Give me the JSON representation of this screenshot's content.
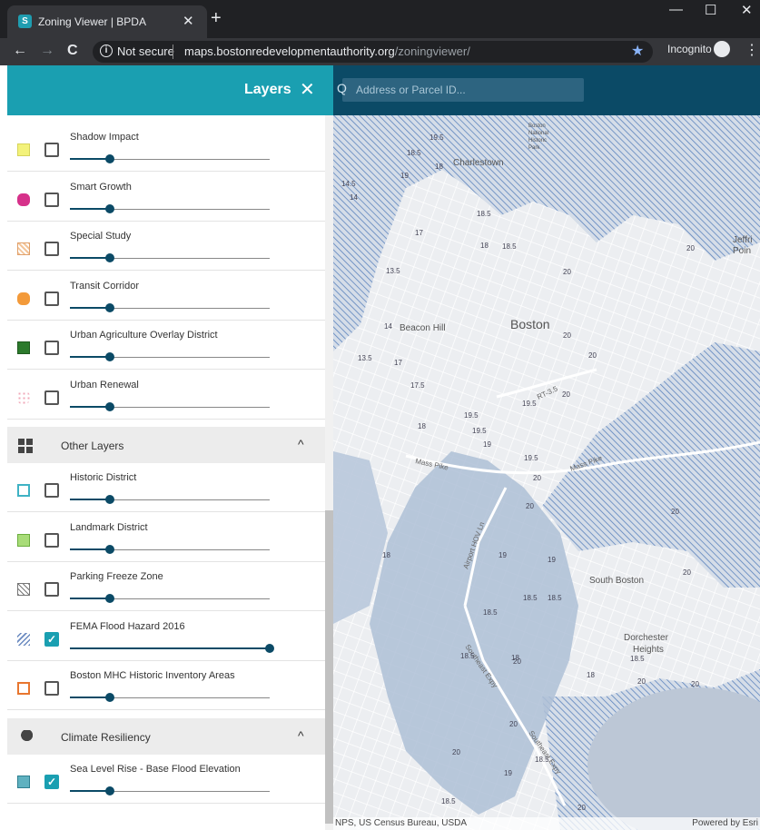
{
  "browser": {
    "tab_title": "Zoning Viewer | BPDA",
    "tab_favicon": "S",
    "tab_close": "✕",
    "new_tab": "+",
    "window_controls": {
      "minimize": "—",
      "maximize": "☐",
      "close": "✕"
    },
    "nav": {
      "back": "←",
      "forward": "→",
      "reload": "C"
    },
    "security_label": "Not secure",
    "url_host": "maps.bostonredevelopmentauthority.org",
    "url_path": "/zoningviewer/",
    "bookmark_star": "★",
    "incognito_label": "Incognito",
    "menu": "⋮"
  },
  "panel": {
    "title": "Layers",
    "close": "✕",
    "rows_top": [
      {
        "label": "Shadow Impact",
        "checked": false,
        "swatch": "yellow-square",
        "opacity": 0.2
      },
      {
        "label": "Smart Growth",
        "checked": false,
        "swatch": "magenta-blob",
        "opacity": 0.2
      },
      {
        "label": "Special Study",
        "checked": false,
        "swatch": "orange-hatched-square",
        "opacity": 0.2
      },
      {
        "label": "Transit Corridor",
        "checked": false,
        "swatch": "orange-blob",
        "opacity": 0.2
      },
      {
        "label": "Urban Agriculture Overlay District",
        "checked": false,
        "swatch": "green-leaf-square",
        "opacity": 0.2
      },
      {
        "label": "Urban Renewal",
        "checked": false,
        "swatch": "pink-dotted-blob",
        "opacity": 0.2
      }
    ],
    "section_other": {
      "title": "Other Layers",
      "chevron": "^"
    },
    "rows_other": [
      {
        "label": "Historic District",
        "checked": false,
        "swatch": "teal-outline-square",
        "opacity": 0.2
      },
      {
        "label": "Landmark District",
        "checked": false,
        "swatch": "green-square",
        "opacity": 0.2
      },
      {
        "label": "Parking Freeze Zone",
        "checked": false,
        "swatch": "grey-crosshatch-square",
        "opacity": 0.2
      },
      {
        "label": "FEMA Flood Hazard 2016",
        "checked": true,
        "swatch": "blue-hatch",
        "opacity": 1.0
      },
      {
        "label": "Boston MHC Historic Inventory Areas",
        "checked": false,
        "swatch": "orange-outline-square",
        "opacity": 0.2
      }
    ],
    "section_climate": {
      "title": "Climate Resiliency",
      "chevron": "^"
    },
    "rows_climate": [
      {
        "label": "Sea Level Rise - Base Flood Elevation",
        "checked": true,
        "swatch": "teal-square",
        "opacity": 0.2
      }
    ],
    "checkmark": "✓"
  },
  "map": {
    "search_icon": "Q",
    "search_placeholder": "Address or Parcel ID...",
    "place_labels": [
      "Charlestown",
      "Boston",
      "Beacon Hill",
      "South Boston",
      "Dorchester",
      "Heights",
      "Jeffri",
      "Poin",
      "Boston",
      "National",
      "Historic",
      "Park"
    ],
    "road_labels": [
      "Mass Pike",
      "Mass Pike",
      "RT-3.5",
      "Airport HOV Ln",
      "Southeast Expy",
      "Southeast Expy"
    ],
    "elevation_labels": [
      "19.5",
      "18.5",
      "19",
      "18",
      "14.5",
      "14",
      "17",
      "18.5",
      "18",
      "18.5",
      "20",
      "13.5",
      "20",
      "20",
      "14",
      "13.5",
      "17",
      "17.5",
      "18",
      "19.5",
      "19.5",
      "19.5",
      "19",
      "19.5",
      "20",
      "20",
      "20",
      "20",
      "20",
      "19",
      "19",
      "18",
      "18.5",
      "18.5",
      "18.5",
      "18.5",
      "18",
      "18.5",
      "20",
      "20",
      "20",
      "19",
      "18.5",
      "18",
      "18.5",
      "20",
      "20",
      "20",
      "20"
    ],
    "attribution_left": "NPS, US Census Bureau, USDA",
    "attribution_right": "Powered by Esri"
  },
  "colors": {
    "teal": "#1a9fb1",
    "navy": "#0b4a66",
    "flood_blue": "#7e9cc8",
    "water": "#bcc7d6"
  }
}
